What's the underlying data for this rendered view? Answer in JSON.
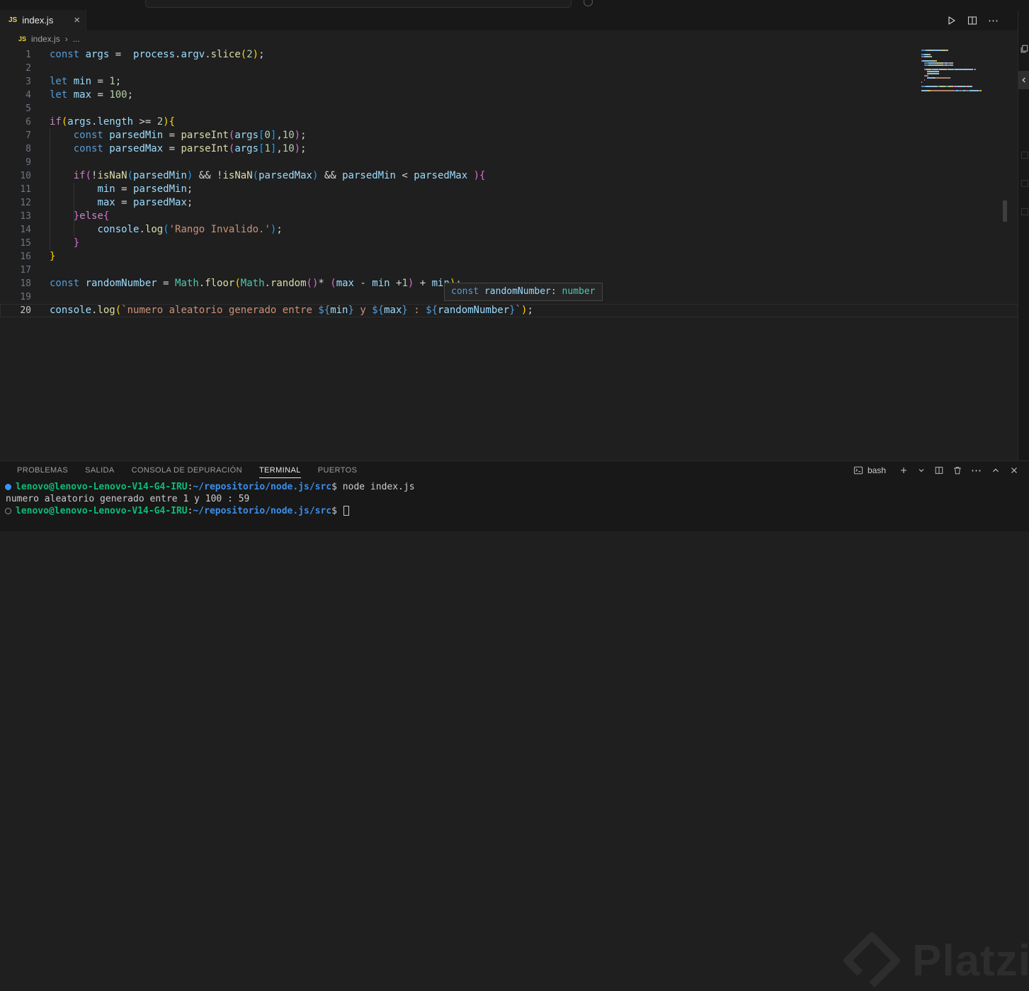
{
  "colors": {
    "kw": "#569CD6",
    "ctrl": "#C586C0",
    "var": "#9CDCFE",
    "fn": "#DCDCAA",
    "num": "#B5CEA8",
    "str": "#CE9178",
    "fg": "#D4D4D4",
    "p1": "#FFD700",
    "p2": "#DA70D6",
    "p3": "#179FFF",
    "cls": "#4EC9B0",
    "tgreen": "#0DBC79",
    "tblue": "#3B8EEA",
    "tfg": "#CCCCCC"
  },
  "icons": {
    "close": "×",
    "more": "⋯",
    "js_badge": "JS",
    "breadcrumb_chevron": "›",
    "breadcrumb_more": "..."
  },
  "tab": {
    "label": "index.js",
    "icon_label": "JS"
  },
  "breadcrumb": {
    "file": "index.js",
    "icon_label": "JS"
  },
  "editor": {
    "current_line": 20,
    "lines": [
      {
        "n": 1,
        "segments": [
          {
            "t": "const ",
            "c": "kw"
          },
          {
            "t": "args",
            "c": "var"
          },
          {
            "t": " =  ",
            "c": "fg"
          },
          {
            "t": "process",
            "c": "var"
          },
          {
            "t": ".",
            "c": "fg"
          },
          {
            "t": "argv",
            "c": "var"
          },
          {
            "t": ".",
            "c": "fg"
          },
          {
            "t": "slice",
            "c": "fn"
          },
          {
            "t": "(",
            "c": "p1"
          },
          {
            "t": "2",
            "c": "num"
          },
          {
            "t": ")",
            "c": "p1"
          },
          {
            "t": ";",
            "c": "fg"
          }
        ]
      },
      {
        "n": 2,
        "segments": []
      },
      {
        "n": 3,
        "segments": [
          {
            "t": "let ",
            "c": "kw"
          },
          {
            "t": "min",
            "c": "var"
          },
          {
            "t": " = ",
            "c": "fg"
          },
          {
            "t": "1",
            "c": "num"
          },
          {
            "t": ";",
            "c": "fg"
          }
        ]
      },
      {
        "n": 4,
        "segments": [
          {
            "t": "let ",
            "c": "kw"
          },
          {
            "t": "max",
            "c": "var"
          },
          {
            "t": " = ",
            "c": "fg"
          },
          {
            "t": "100",
            "c": "num"
          },
          {
            "t": ";",
            "c": "fg"
          }
        ]
      },
      {
        "n": 5,
        "segments": []
      },
      {
        "n": 6,
        "segments": [
          {
            "t": "if",
            "c": "ctrl"
          },
          {
            "t": "(",
            "c": "p1"
          },
          {
            "t": "args",
            "c": "var"
          },
          {
            "t": ".",
            "c": "fg"
          },
          {
            "t": "length",
            "c": "var"
          },
          {
            "t": " >= ",
            "c": "fg"
          },
          {
            "t": "2",
            "c": "num"
          },
          {
            "t": ")",
            "c": "p1"
          },
          {
            "t": "{",
            "c": "p1"
          }
        ]
      },
      {
        "n": 7,
        "segments": [
          {
            "t": "    ",
            "c": "fg"
          },
          {
            "t": "const ",
            "c": "kw"
          },
          {
            "t": "parsedMin",
            "c": "var"
          },
          {
            "t": " = ",
            "c": "fg"
          },
          {
            "t": "parseInt",
            "c": "fn"
          },
          {
            "t": "(",
            "c": "p2"
          },
          {
            "t": "args",
            "c": "var"
          },
          {
            "t": "[",
            "c": "p3"
          },
          {
            "t": "0",
            "c": "num"
          },
          {
            "t": "]",
            "c": "p3"
          },
          {
            "t": ",",
            "c": "fg"
          },
          {
            "t": "10",
            "c": "num"
          },
          {
            "t": ")",
            "c": "p2"
          },
          {
            "t": ";",
            "c": "fg"
          }
        ]
      },
      {
        "n": 8,
        "segments": [
          {
            "t": "    ",
            "c": "fg"
          },
          {
            "t": "const ",
            "c": "kw"
          },
          {
            "t": "parsedMax",
            "c": "var"
          },
          {
            "t": " = ",
            "c": "fg"
          },
          {
            "t": "parseInt",
            "c": "fn"
          },
          {
            "t": "(",
            "c": "p2"
          },
          {
            "t": "args",
            "c": "var"
          },
          {
            "t": "[",
            "c": "p3"
          },
          {
            "t": "1",
            "c": "num"
          },
          {
            "t": "]",
            "c": "p3"
          },
          {
            "t": ",",
            "c": "fg"
          },
          {
            "t": "10",
            "c": "num"
          },
          {
            "t": ")",
            "c": "p2"
          },
          {
            "t": ";",
            "c": "fg"
          }
        ]
      },
      {
        "n": 9,
        "segments": []
      },
      {
        "n": 10,
        "segments": [
          {
            "t": "    ",
            "c": "fg"
          },
          {
            "t": "if",
            "c": "ctrl"
          },
          {
            "t": "(",
            "c": "p2"
          },
          {
            "t": "!",
            "c": "fg"
          },
          {
            "t": "isNaN",
            "c": "fn"
          },
          {
            "t": "(",
            "c": "p3"
          },
          {
            "t": "parsedMin",
            "c": "var"
          },
          {
            "t": ")",
            "c": "p3"
          },
          {
            "t": " && !",
            "c": "fg"
          },
          {
            "t": "isNaN",
            "c": "fn"
          },
          {
            "t": "(",
            "c": "p3"
          },
          {
            "t": "parsedMax",
            "c": "var"
          },
          {
            "t": ")",
            "c": "p3"
          },
          {
            "t": " && ",
            "c": "fg"
          },
          {
            "t": "parsedMin",
            "c": "var"
          },
          {
            "t": " < ",
            "c": "fg"
          },
          {
            "t": "parsedMax",
            "c": "var"
          },
          {
            "t": " ",
            "c": "fg"
          },
          {
            "t": ")",
            "c": "p2"
          },
          {
            "t": "{",
            "c": "p2"
          }
        ]
      },
      {
        "n": 11,
        "segments": [
          {
            "t": "        ",
            "c": "fg"
          },
          {
            "t": "min",
            "c": "var"
          },
          {
            "t": " = ",
            "c": "fg"
          },
          {
            "t": "parsedMin",
            "c": "var"
          },
          {
            "t": ";",
            "c": "fg"
          }
        ]
      },
      {
        "n": 12,
        "segments": [
          {
            "t": "        ",
            "c": "fg"
          },
          {
            "t": "max",
            "c": "var"
          },
          {
            "t": " = ",
            "c": "fg"
          },
          {
            "t": "parsedMax",
            "c": "var"
          },
          {
            "t": ";",
            "c": "fg"
          }
        ]
      },
      {
        "n": 13,
        "segments": [
          {
            "t": "    ",
            "c": "fg"
          },
          {
            "t": "}",
            "c": "p2"
          },
          {
            "t": "else",
            "c": "ctrl"
          },
          {
            "t": "{",
            "c": "p2"
          }
        ]
      },
      {
        "n": 14,
        "segments": [
          {
            "t": "        ",
            "c": "fg"
          },
          {
            "t": "console",
            "c": "var"
          },
          {
            "t": ".",
            "c": "fg"
          },
          {
            "t": "log",
            "c": "fn"
          },
          {
            "t": "(",
            "c": "p3"
          },
          {
            "t": "'Rango Invalido.'",
            "c": "str"
          },
          {
            "t": ")",
            "c": "p3"
          },
          {
            "t": ";",
            "c": "fg"
          }
        ]
      },
      {
        "n": 15,
        "segments": [
          {
            "t": "    ",
            "c": "fg"
          },
          {
            "t": "}",
            "c": "p2"
          }
        ]
      },
      {
        "n": 16,
        "segments": [
          {
            "t": "}",
            "c": "p1"
          }
        ]
      },
      {
        "n": 17,
        "segments": []
      },
      {
        "n": 18,
        "segments": [
          {
            "t": "const ",
            "c": "kw"
          },
          {
            "t": "randomNumber",
            "c": "var"
          },
          {
            "t": " = ",
            "c": "fg"
          },
          {
            "t": "Math",
            "c": "cls"
          },
          {
            "t": ".",
            "c": "fg"
          },
          {
            "t": "floor",
            "c": "fn"
          },
          {
            "t": "(",
            "c": "p1"
          },
          {
            "t": "Math",
            "c": "cls"
          },
          {
            "t": ".",
            "c": "fg"
          },
          {
            "t": "random",
            "c": "fn"
          },
          {
            "t": "(",
            "c": "p2"
          },
          {
            "t": ")",
            "c": "p2"
          },
          {
            "t": "* ",
            "c": "fg"
          },
          {
            "t": "(",
            "c": "p2"
          },
          {
            "t": "max",
            "c": "var"
          },
          {
            "t": " - ",
            "c": "fg"
          },
          {
            "t": "min",
            "c": "var"
          },
          {
            "t": " +",
            "c": "fg"
          },
          {
            "t": "1",
            "c": "num"
          },
          {
            "t": ")",
            "c": "p2"
          },
          {
            "t": " + ",
            "c": "fg"
          },
          {
            "t": "min",
            "c": "var"
          },
          {
            "t": ")",
            "c": "p1"
          },
          {
            "t": ";",
            "c": "fg"
          }
        ]
      },
      {
        "n": 19,
        "segments": []
      },
      {
        "n": 20,
        "segments": [
          {
            "t": "console",
            "c": "var"
          },
          {
            "t": ".",
            "c": "fg"
          },
          {
            "t": "log",
            "c": "fn"
          },
          {
            "t": "(",
            "c": "p1"
          },
          {
            "t": "`numero aleatorio generado entre ",
            "c": "str"
          },
          {
            "t": "${",
            "c": "kw"
          },
          {
            "t": "min",
            "c": "var"
          },
          {
            "t": "}",
            "c": "kw"
          },
          {
            "t": " y ",
            "c": "str"
          },
          {
            "t": "${",
            "c": "kw"
          },
          {
            "t": "max",
            "c": "var"
          },
          {
            "t": "}",
            "c": "kw"
          },
          {
            "t": " : ",
            "c": "str"
          },
          {
            "t": "${",
            "c": "kw"
          },
          {
            "t": "randomNumber",
            "c": "var"
          },
          {
            "t": "}",
            "c": "kw"
          },
          {
            "t": "`",
            "c": "str"
          },
          {
            "t": ")",
            "c": "p1"
          },
          {
            "t": ";",
            "c": "fg"
          }
        ]
      }
    ],
    "tooltip": {
      "segments": [
        {
          "t": "const ",
          "c": "kw"
        },
        {
          "t": "randomNumber",
          "c": "var"
        },
        {
          "t": ":",
          "c": "fg"
        },
        {
          "t": " number",
          "c": "cls"
        }
      ]
    }
  },
  "panel": {
    "tabs": [
      {
        "label": "PROBLEMAS"
      },
      {
        "label": "SALIDA"
      },
      {
        "label": "CONSOLA DE DEPURACIÓN"
      },
      {
        "label": "TERMINAL",
        "active": true
      },
      {
        "label": "PUERTOS"
      }
    ],
    "shell_label": "bash"
  },
  "terminal": {
    "lines": [
      {
        "decoration": "success",
        "segments": [
          {
            "t": "lenovo@lenovo-Lenovo-V14-G4-IRU",
            "c": "tgreen",
            "b": true
          },
          {
            "t": ":",
            "c": "tfg"
          },
          {
            "t": "~/repositorio/node.js/src",
            "c": "tblue",
            "b": true
          },
          {
            "t": "$",
            "c": "tfg"
          },
          {
            "t": " node index.js",
            "c": "tfg"
          }
        ]
      },
      {
        "segments": [
          {
            "t": "numero aleatorio generado entre 1 y 100 : 59",
            "c": "tfg"
          }
        ]
      },
      {
        "decoration": "pending",
        "cursor": true,
        "segments": [
          {
            "t": "lenovo@lenovo-Lenovo-V14-G4-IRU",
            "c": "tgreen",
            "b": true
          },
          {
            "t": ":",
            "c": "tfg"
          },
          {
            "t": "~/repositorio/node.js/src",
            "c": "tblue",
            "b": true
          },
          {
            "t": "$ ",
            "c": "tfg"
          }
        ]
      }
    ]
  },
  "watermark": {
    "text": "Platzi"
  }
}
